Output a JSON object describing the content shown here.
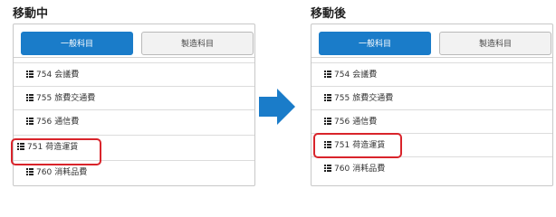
{
  "left": {
    "heading": "移動中",
    "tabs": [
      {
        "label": "一般科目",
        "active": true
      },
      {
        "label": "製造科目",
        "active": false
      }
    ],
    "rows": [
      {
        "code": "754",
        "name": "会議費"
      },
      {
        "code": "755",
        "name": "旅費交通費"
      },
      {
        "code": "756",
        "name": "通信費"
      },
      {
        "code": "751",
        "name": "荷造運賃",
        "highlighted": true
      },
      {
        "code": "760",
        "name": "消耗品費"
      }
    ]
  },
  "right": {
    "heading": "移動後",
    "tabs": [
      {
        "label": "一般科目",
        "active": true
      },
      {
        "label": "製造科目",
        "active": false
      }
    ],
    "rows": [
      {
        "code": "754",
        "name": "会議費"
      },
      {
        "code": "755",
        "name": "旅費交通費"
      },
      {
        "code": "756",
        "name": "通信費"
      },
      {
        "code": "751",
        "name": "荷造運賃",
        "highlighted": true
      },
      {
        "code": "760",
        "name": "消耗品費"
      }
    ]
  },
  "colors": {
    "accent": "#1a7cc9",
    "highlight": "#d9242b",
    "arrow": "#1a7cc9"
  },
  "icons": {
    "list": "list-icon",
    "arrow": "right-arrow-icon"
  }
}
